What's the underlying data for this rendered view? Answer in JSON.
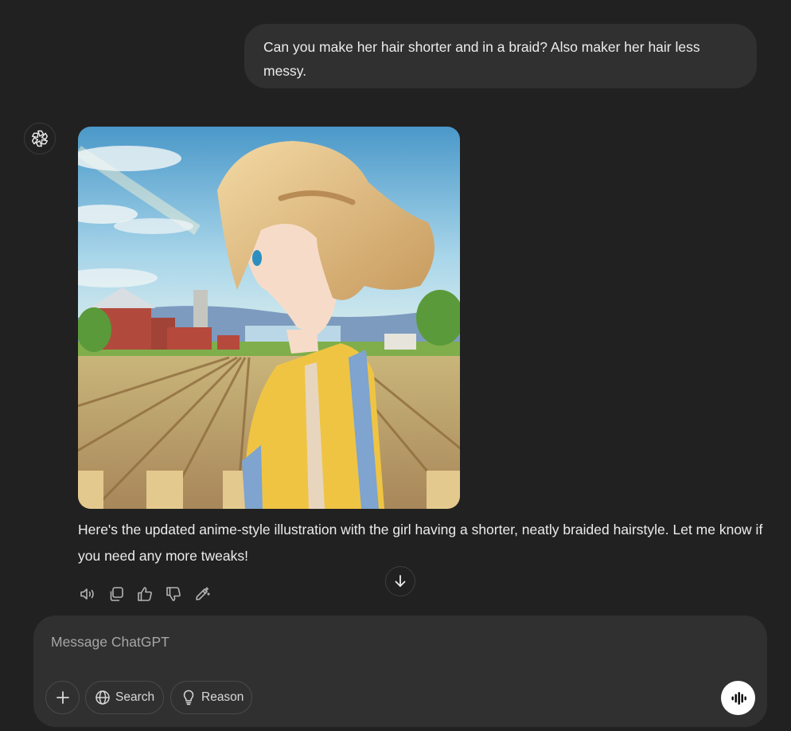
{
  "conversation": {
    "user_message": "Can you make her hair shorter and in a braid? Also maker her hair less messy.",
    "assistant": {
      "avatar_icon": "chatgpt-logo-icon",
      "image_icon": "generated-anime-illustration",
      "message": "Here's the updated anime-style illustration with the girl having a shorter, neatly braided hairstyle. Let me know if you need any more tweaks!"
    },
    "actions": [
      {
        "icon": "speaker-icon"
      },
      {
        "icon": "copy-icon"
      },
      {
        "icon": "thumbs-up-icon"
      },
      {
        "icon": "thumbs-down-icon"
      },
      {
        "icon": "edit-image-icon"
      }
    ]
  },
  "composer": {
    "placeholder": "Message ChatGPT",
    "search_label": "Search",
    "reason_label": "Reason"
  },
  "colors": {
    "background": "#212121",
    "bubble": "#303030",
    "text": "#ececec",
    "muted": "#b4b4b4"
  }
}
